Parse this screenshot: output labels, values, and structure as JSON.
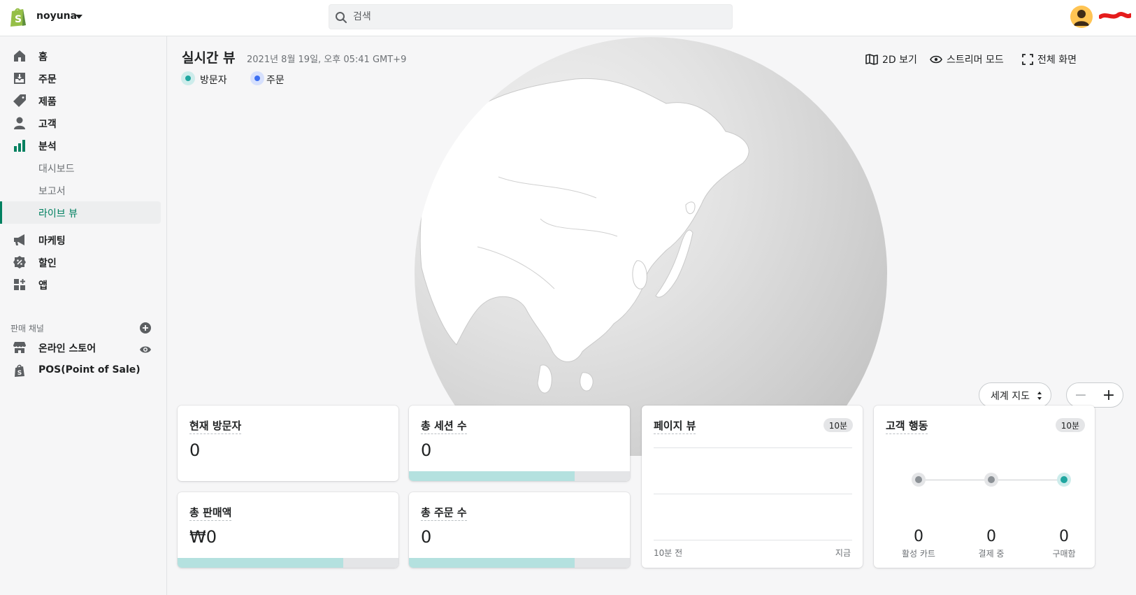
{
  "topbar": {
    "store_name": "noyuna",
    "search_placeholder": "검색"
  },
  "sidebar": {
    "items": [
      {
        "label": "홈",
        "icon": "home-icon"
      },
      {
        "label": "주문",
        "icon": "orders-icon"
      },
      {
        "label": "제품",
        "icon": "tag-icon"
      },
      {
        "label": "고객",
        "icon": "customer-icon"
      },
      {
        "label": "분석",
        "icon": "analytics-icon"
      }
    ],
    "sub_items": [
      {
        "label": "대시보드"
      },
      {
        "label": "보고서"
      },
      {
        "label": "라이브 뷰",
        "active": true
      }
    ],
    "items2": [
      {
        "label": "마케팅",
        "icon": "megaphone-icon"
      },
      {
        "label": "할인",
        "icon": "discount-icon"
      },
      {
        "label": "앱",
        "icon": "apps-icon"
      }
    ],
    "channels_heading": "판매 채널",
    "channels": [
      {
        "label": "온라인 스토어",
        "icon": "store-icon"
      },
      {
        "label": "POS(Point of Sale)",
        "icon": "pos-bag-icon"
      }
    ]
  },
  "main": {
    "title": "실시간 뷰",
    "timestamp": "2021년 8월 19일, 오후 05:41 GMT+9",
    "legend": {
      "visitors": "방문자",
      "orders": "주문"
    },
    "actions": {
      "view_2d": "2D 보기",
      "streamer": "스트리머 모드",
      "fullscreen": "전체 화면"
    },
    "map_select": "세계 지도",
    "zoom_minus": "−",
    "zoom_plus": "+"
  },
  "cards": {
    "current_visitors": {
      "title": "현재 방문자",
      "value": "0"
    },
    "total_sessions": {
      "title": "총 세션 수",
      "value": "0",
      "bar_fraction": 0.75
    },
    "total_sales": {
      "title": "총 판매액",
      "value": "₩0",
      "bar_fraction": 0.75
    },
    "total_orders": {
      "title": "총 주문 수",
      "value": "0",
      "bar_fraction": 0.75
    },
    "page_views": {
      "title": "페이지 뷰",
      "badge": "10분",
      "x_start": "10분 전",
      "x_end": "지금"
    },
    "customer_behavior": {
      "title": "고객 행동",
      "badge": "10분",
      "steps": [
        {
          "label": "활성 카트",
          "value": "0"
        },
        {
          "label": "결제 중",
          "value": "0"
        },
        {
          "label": "구매함",
          "value": "0"
        }
      ]
    }
  },
  "colors": {
    "accent_green": "#008060",
    "visitor_teal": "#1fa6a0",
    "order_blue": "#3c6ff2"
  }
}
